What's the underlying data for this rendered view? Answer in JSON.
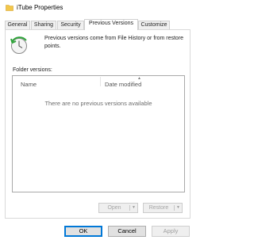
{
  "window": {
    "title": "iTube Properties",
    "icon": "folder-icon"
  },
  "tabs": [
    {
      "label": "General",
      "active": false
    },
    {
      "label": "Sharing",
      "active": false
    },
    {
      "label": "Security",
      "active": false
    },
    {
      "label": "Previous Versions",
      "active": true
    },
    {
      "label": "Customize",
      "active": false
    }
  ],
  "previous_versions": {
    "icon": "restore-clock-icon",
    "intro_text": "Previous versions come from File History or from restore points.",
    "folder_versions_label": "Folder versions:",
    "columns": {
      "name": "Name",
      "date_modified": "Date modified"
    },
    "empty_message": "There are no previous versions available",
    "open_label": "Open",
    "restore_label": "Restore"
  },
  "footer": {
    "ok_label": "OK",
    "cancel_label": "Cancel",
    "apply_label": "Apply"
  },
  "colors": {
    "accent": "#0078d7",
    "restore_green": "#2fa43a"
  }
}
